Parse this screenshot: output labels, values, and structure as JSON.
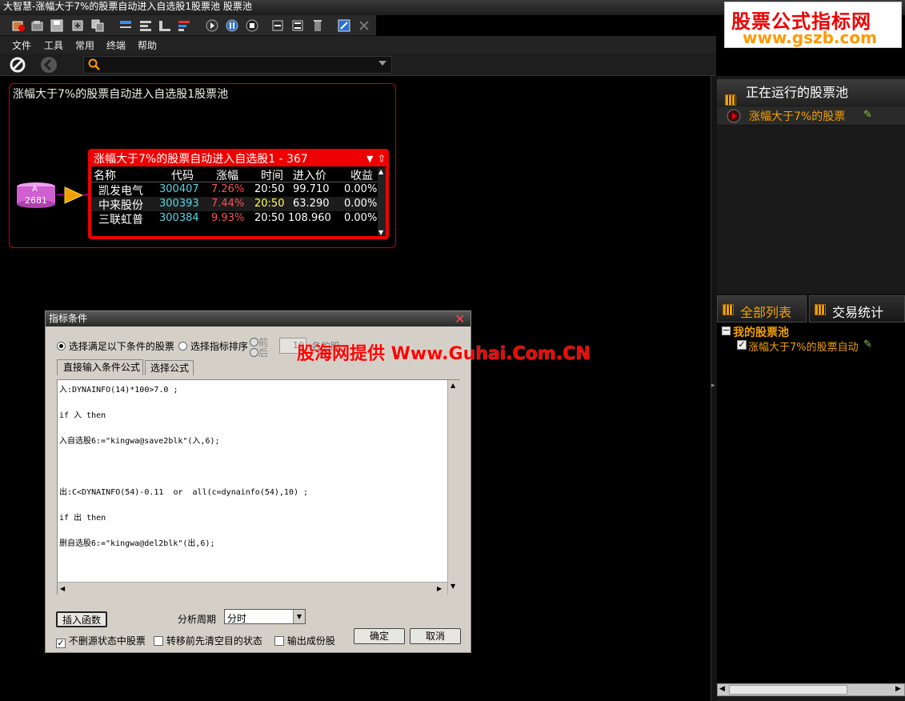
{
  "window": {
    "title": "大智慧-涨幅大于7%的股票自动进入自选股1股票池  股票池"
  },
  "menubar": {
    "items": [
      "文件",
      "工具",
      "常用",
      "终端",
      "帮助"
    ]
  },
  "logo": {
    "line1": "股票公式指标网",
    "line2": "www.gszb.com"
  },
  "pool": {
    "box_title": "涨幅大于7%的股票自动进入自选股1股票池",
    "source_label": "A",
    "source_count": "2681",
    "grid_title": "涨幅大于7%的股票自动进入自选股1 - 367",
    "columns": [
      "名称",
      "代码",
      "涨幅",
      "时间",
      "进入价",
      "收益"
    ],
    "rows": [
      {
        "name": "凯发电气",
        "code": "300407",
        "change": "7.26%",
        "time": "20:50",
        "price": "99.710",
        "gain": "0.00%"
      },
      {
        "name": "中来股份",
        "code": "300393",
        "change": "7.44%",
        "time": "20:50",
        "price": "63.290",
        "gain": "0.00%"
      },
      {
        "name": "三联虹普",
        "code": "300384",
        "change": "9.93%",
        "time": "20:50",
        "price": "108.960",
        "gain": "0.00%"
      }
    ]
  },
  "right": {
    "running_header": "正在运行的股票池",
    "running_item": "涨幅大于7%的股票",
    "tab_all": "全部列表",
    "tab_stats": "交易统计",
    "tree_root": "我的股票池",
    "tree_item": "涨幅大于7%的股票自动"
  },
  "dialog": {
    "title": "指标条件",
    "radio1": "选择满足以下条件的股票",
    "radio2": "选择指标排序",
    "order_front": "前",
    "order_back": "后",
    "count_value": "10",
    "count_suffix": "名的股",
    "tab_direct": "直接输入条件公式",
    "tab_select": "选择公式",
    "code_lines": [
      "入:DYNAINFO(14)*100>7.0 ;",
      "if 入 then",
      "入自选股6:=\"kingwa@save2blk\"(入,6);",
      "出:C<DYNAINFO(54)-0.11  or  all(c=dynainfo(54),10) ;",
      "if 出 then",
      "删自选股6:=\"kingwa@del2blk\"(出,6);"
    ],
    "insert_btn": "插入函数",
    "period_label": "分析周期",
    "period_value": "分时",
    "chk1": "不删源状态中股票",
    "chk2": "转移前先清空目的状态",
    "chk3": "输出成份股",
    "ok": "确定",
    "cancel": "取消"
  },
  "watermark": "股海网提供 Www.Guhai.Com.CN",
  "colors": {
    "accent_red": "#e00000",
    "orange": "#e8a000",
    "code_cyan": "#4fd8e8",
    "change_red": "#ff5050"
  }
}
